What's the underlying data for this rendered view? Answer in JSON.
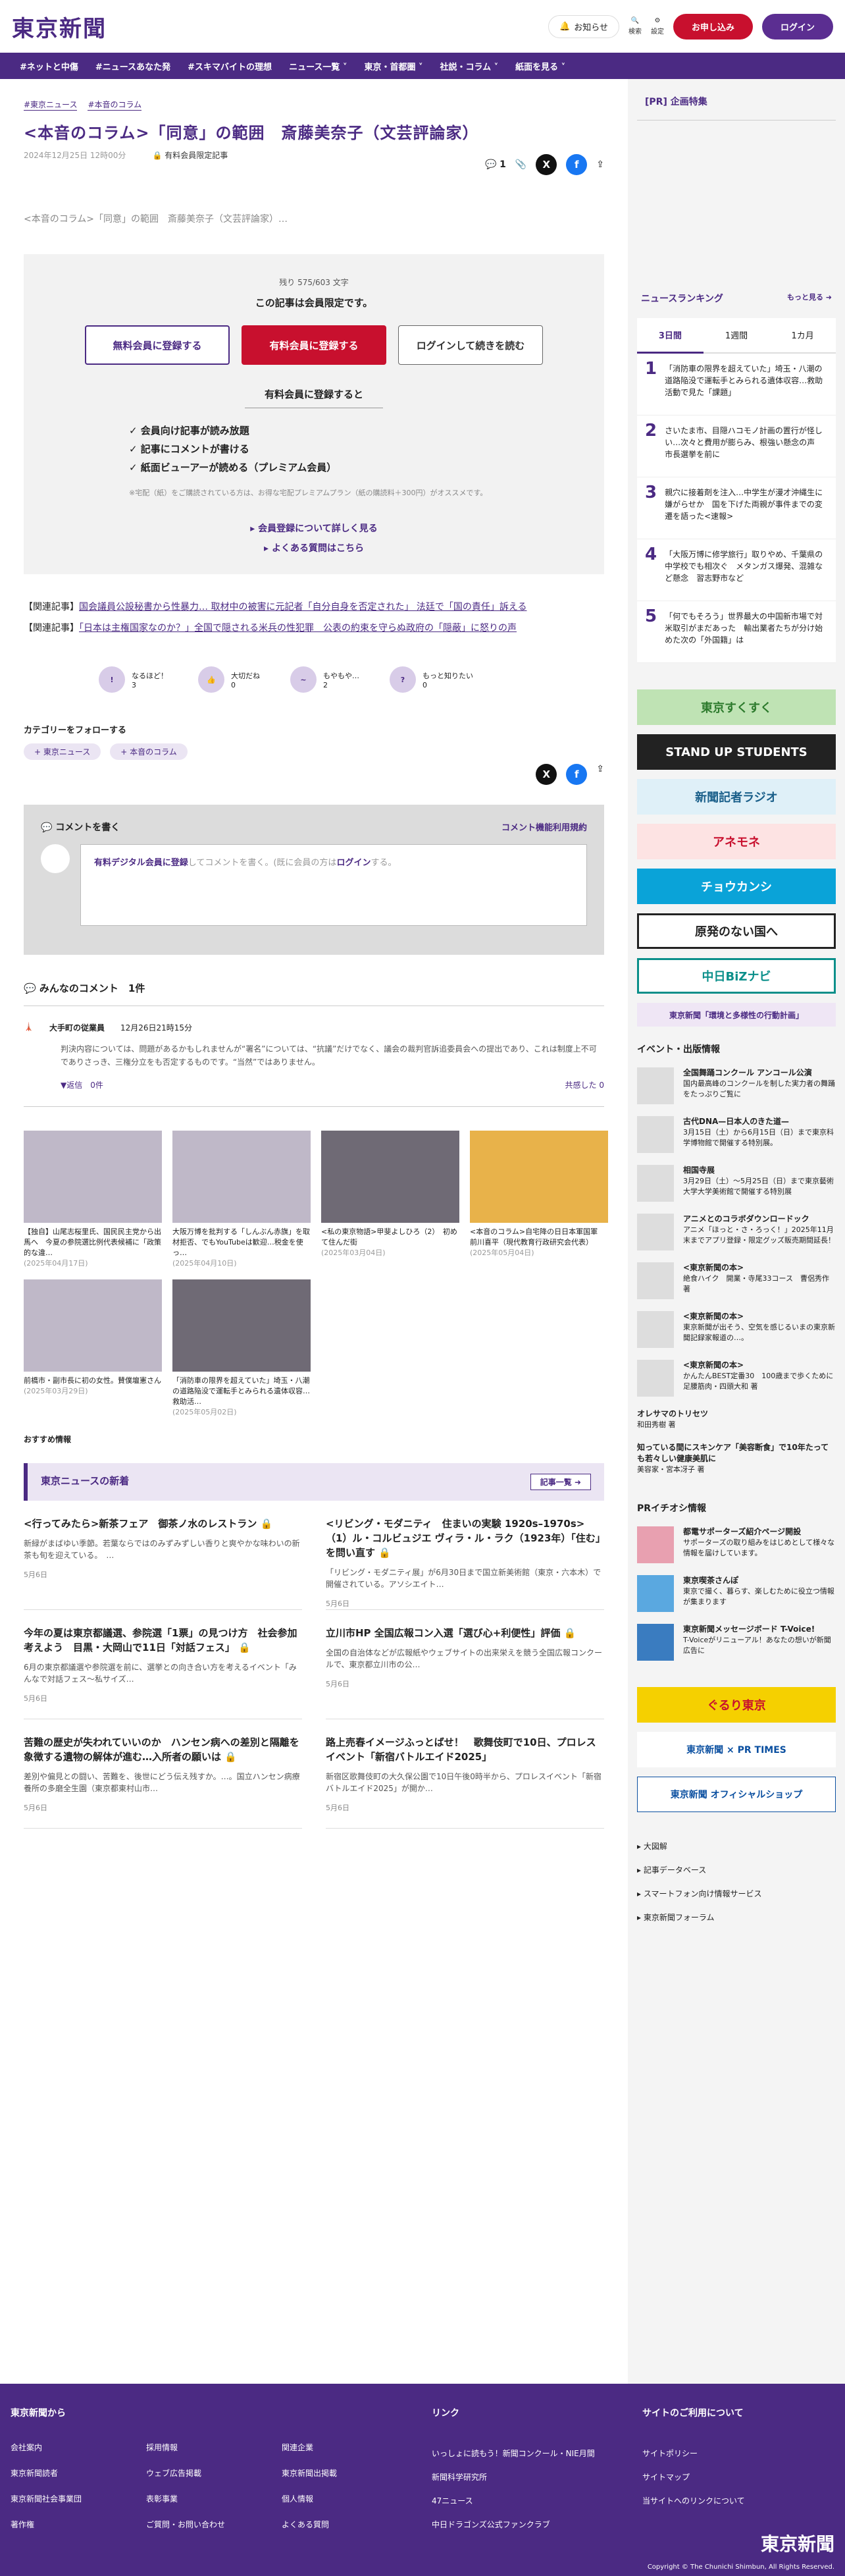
{
  "header": {
    "logo": "東京新聞",
    "notify": "お知らせ",
    "search": "検索",
    "settings": "設定",
    "signup": "お申し込み",
    "login": "ログイン"
  },
  "nav": [
    "#ネットと中傷",
    "#ニュースあなた発",
    "#スキマバイトの理想",
    "ニュース一覧 ˅",
    "東京・首都圏 ˅",
    "社説・コラム ˅",
    "紙面を見る ˅"
  ],
  "article": {
    "crumbs": [
      "#東京ニュース",
      "#本音のコラム"
    ],
    "title": "<本音のコラム>「同意」の範囲　斎藤美奈子（文芸評論家）",
    "date": "2024年12月25日 12時00分",
    "member_only": "有料会員限定記事",
    "comments_count": "1",
    "lead": "<本音のコラム>「同意」の範囲　斎藤美奈子（文芸評論家）…"
  },
  "paywall": {
    "remain": "残り 575/603 文字",
    "notice": "この記事は会員限定です。",
    "free_btn": "無料会員に登録する",
    "paid_btn": "有料会員に登録する",
    "login_btn": "ログインして続きを読む",
    "benefit_title": "有料会員に登録すると",
    "benefits": [
      "✓ 会員向け記事が読み放題",
      "✓ 記事にコメントが書ける",
      "✓ 紙面ビューアーが読める（プレミアム会員）"
    ],
    "note": "※宅配（紙）をご購読されている方は、お得な宅配プレミアムプラン（紙の購読料＋300円）がオススメです。",
    "link1": "▸ 会員登録について詳しく見る",
    "link2": "▸ よくある質問はこちら"
  },
  "related": [
    {
      "label": "【関連記事】",
      "text": "国会議員公設秘書から性暴力… 取材中の被害に元記者「自分自身を否定された」 法廷で「国の責任」訴える"
    },
    {
      "label": "【関連記事】",
      "text": "「日本は主権国家なのか？」全国で隠される米兵の性犯罪　公表の約束を守らぬ政府の「隠蔽」に怒りの声"
    }
  ],
  "reactions": [
    {
      "label": "なるほど！",
      "count": "3"
    },
    {
      "label": "大切だね",
      "count": "0"
    },
    {
      "label": "もやもや…",
      "count": "2"
    },
    {
      "label": "もっと知りたい",
      "count": "0"
    }
  ],
  "follow": {
    "title": "カテゴリーをフォローする",
    "tags": [
      "+ 東京ニュース",
      "+ 本音のコラム"
    ]
  },
  "comment_box": {
    "title": "コメントを書く",
    "terms": "コメント機能利用規約",
    "prompt_link": "有料デジタル会員に登録",
    "prompt_mid": "してコメントを書く。(既に会員の方は",
    "prompt_login": "ログイン",
    "prompt_end": "する。"
  },
  "comments": {
    "title": "みんなのコメント　1件",
    "items": [
      {
        "name": "大手町の従業員",
        "date": "12月26日21時15分",
        "body": "判決内容については、問題があるかもしれませんが“署名”については、“抗議”だけでなく、議会の裁判官訴追委員会への提出であり、これは制度上不可でありさっき、三権分立をも否定するものです。“当然”ではありません。",
        "reply": "▼返信　0件",
        "like": "共感した 0"
      }
    ]
  },
  "thumbs": [
    {
      "title": "【独自】山尾志桜里氏、国民民主党から出馬へ　今夏の参院選比例代表候補に「政策的な違…",
      "date": "(2025年04月17日)"
    },
    {
      "title": "大阪万博を批判する「しんぶん赤旗」を取材拒否、でもYouTubeは歓迎…税金を使っ…",
      "date": "(2025年04月10日)"
    },
    {
      "title": "<私の東京物語>甲斐よしひろ（2）　初めて住んだ街",
      "date": "(2025年03月04日)"
    },
    {
      "title": "<本音のコラム>自宅降の日日本軍国軍　前川喜平（現代教育行政研究会代表）",
      "date": "(2025年05月04日)"
    },
    {
      "title": "前橋市・副市長に初の女性。賛僕壇憲さん",
      "date": "(2025年03月29日)"
    },
    {
      "title": "「消防車の限界を超えていた」埼玉・八潮の道路陥没で運転手とみられる遺体収容…救助活…",
      "date": "(2025年05月02日)"
    }
  ],
  "recommend": "おすすめ情報",
  "news": {
    "title": "東京ニュースの新着",
    "more": "記事一覧 ➜",
    "items": [
      {
        "title": "<行ってみたら>新茶フェア　御茶ノ水のレストラン 🔒",
        "body": "新緑がまばゆい季節。若葉ならではのみずみずしい香りと爽やかな味わいの新茶も旬を迎えている。　…",
        "date": "5月6日"
      },
      {
        "title": "<リビング・モダニティ　住まいの実験 1920s–1970s>（1）ル・コルビュジエ ヴィラ・ル・ラク（1923年）「住む」を問い直す 🔒",
        "body": "「リビング・モダニティ展」が6月30日まで国立新美術館（東京・六本木）で開催されている。アソシエイト…",
        "date": "5月6日"
      },
      {
        "title": "今年の夏は東京都議選、参院選「1票」の見つけ方　社会参加考えよう　目黒・大岡山で11日「対話フェス」 🔒",
        "body": "6月の東京都議選や参院選を前に、選挙との向き合い方を考えるイベント「みんなで対話フェス〜私サイズ…",
        "date": "5月6日"
      },
      {
        "title": "立川市HP 全国広報コン入選「選び心+利便性」評価 🔒",
        "body": "全国の自治体などが広報紙やウェブサイトの出来栄えを競う全国広報コンクールで、東京都立川市の公…",
        "date": "5月6日"
      },
      {
        "title": "苦難の歴史が失われていいのか　ハンセン病への差別と隔離を象徴する遺物の解体が進む…入所者の願いは 🔒",
        "body": "差別や偏見との闘い、苦難を、後世にどう伝え残すか。…。国立ハンセン病療養所の多磨全生園（東京都東村山市…",
        "date": "5月6日"
      },
      {
        "title": "路上売春イメージふっとばせ！　歌舞伎町で10日、プロレスイベント「新宿バトルエイド2025」",
        "body": "新宿区歌舞伎町の大久保公園で10日午後0時半から、プロレスイベント「新宿バトルエイド2025」が開か…",
        "date": "5月6日"
      }
    ]
  },
  "sidebar": {
    "pr": "[PR] 企画特集",
    "ranking_title": "ニュースランキング",
    "ranking_more": "もっと見る ➜",
    "tabs": [
      "3日間",
      "1週間",
      "1カ月"
    ],
    "ranking": [
      "「消防車の限界を超えていた」埼玉・八潮の道路陥没で運転手とみられる遺体収容…救助活動で見た「課題」",
      "さいたま市、目隠ハコモノ計画の置行が怪しい…次々と費用が膨らみ、根強い懸念の声　市長選挙を前に",
      "親穴に接着剤を注入…中学生が漫才沖縄生に嫌がらせか　国を下げた両親が事件までの変遷を語った<速報>",
      "「大阪万博に修学旅行」取りやめ、千葉県の中学校でも相次ぐ　メタンガス爆発、混雑など懸念　習志野市など",
      "「何でもそろう」世界最大の中国新市場で対米取引がまだあった　輸出業者たちが分け始めた次の「外国籍」は"
    ],
    "banners": [
      "東京すくすく",
      "STAND UP STUDENTS",
      "新聞記者ラジオ",
      "アネモネ",
      "チョウカンシ",
      "原発のない国へ",
      "中日BiZナビ",
      "東京新聞「環境と多様性の行動計画」"
    ],
    "events_title": "イベント・出版情報",
    "events": [
      {
        "title": "全国舞踊コンクール アンコール公演",
        "body": "国内最高峰のコンクールを制した実力者の舞踊をたっぷりご覧に"
      },
      {
        "title": "古代DNA—日本人のきた道—",
        "body": "3月15日（土）から6月15日（日）まで東京科学博物館で開催する特別展。"
      },
      {
        "title": "相国寺展",
        "body": "3月29日（土）〜5月25日（日）まで東京藝術大学大学美術館で開催する特別展"
      },
      {
        "title": "アニメとのコラボダウンロードック",
        "body": "アニメ「ほっと・さ・ろっく！」2025年11月末までアプリ登録・限定グッズ販売期間延長！"
      },
      {
        "title": "<東京新聞の本>",
        "body": "絶食ハイク　開業・寺尾33コース　曹侶秀作 著"
      },
      {
        "title": "<東京新聞の本>",
        "body": "東京新聞が出そう、空気を感じるいまの東京新聞記録家報道の…。"
      },
      {
        "title": "<東京新聞の本>",
        "body": "かんたんBEST定番30　100歳まで歩くために　足腰筋肉・四頭大和 著"
      }
    ],
    "mini_links": [
      {
        "title": "オレサマのトリセツ",
        "body": "和田秀樹 著"
      },
      {
        "title": "知っている間にスキンケア「美容断食」で10年たっても若々しい健康美肌に",
        "body": "美容家・宮本冴子 著"
      }
    ],
    "pr_title": "PRイチオシ情報",
    "prs": [
      {
        "title": "都電サポーターズ紹介ページ開設",
        "body": "サポーターズの取り組みをはじめとして様々な情報を届けしています。"
      },
      {
        "title": "東京喫茶さんぽ",
        "body": "東京で撮く、暮らす、楽しむために役立つ情報が集まります"
      },
      {
        "title": "東京新聞メッセージボード T-Voice!",
        "body": "T-Voiceがリニューアル！あなたの想いが新聞広告に"
      }
    ],
    "banner2": [
      "ぐるり東京",
      "東京新聞 × PR TIMES",
      "東京新聞 オフィシャルショップ"
    ],
    "links": [
      "▸ 大図解",
      "▸ 記事データベース",
      "▸ スマートフォン向け情報サービス",
      "▸ 東京新聞フォーラム"
    ]
  },
  "footer": {
    "col1_title": "東京新聞から",
    "col1": [
      "会社案内",
      "採用情報",
      "関連企業",
      "東京新聞読者",
      "ウェブ広告掲載",
      "東京新聞出掲載",
      "東京新聞社会事業団",
      "表彰事業",
      "個人情報",
      "著作権",
      "ご質問・お問い合わせ",
      "よくある質問"
    ],
    "col2_title": "リンク",
    "col2": [
      "いっしょに読もう！新聞コンクール・NIE月間",
      "新聞科学研究所",
      "47ニュース",
      "中日ドラゴンズ公式ファンクラブ"
    ],
    "col3_title": "サイトのご利用について",
    "col3": [
      "サイトポリシー",
      "サイトマップ",
      "当サイトへのリンクについて"
    ],
    "logo": "東京新聞",
    "copy": "Copyright © The Chunichi Shimbun, All Rights Reserved."
  }
}
